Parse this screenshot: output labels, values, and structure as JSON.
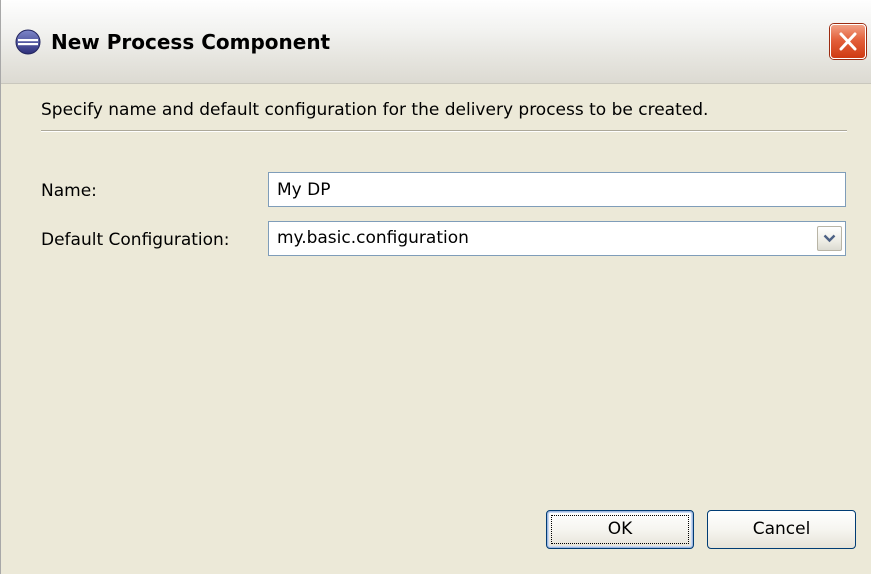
{
  "window": {
    "title": "New Process Component",
    "icon": "eclipse-icon",
    "close_icon": "close-icon"
  },
  "description": "Specify name and default configuration for the delivery process to be created.",
  "form": {
    "name_label": "Name:",
    "name_value": "My DP",
    "config_label": "Default Configuration:",
    "config_value": "my.basic.configuration",
    "config_arrow_icon": "chevron-down-icon"
  },
  "buttons": {
    "ok_label": "OK",
    "cancel_label": "Cancel"
  },
  "colors": {
    "dialog_bg": "#ece9d8",
    "close_button": "#e3603b",
    "input_border": "#7f9db9",
    "default_button_border": "#003c74"
  }
}
